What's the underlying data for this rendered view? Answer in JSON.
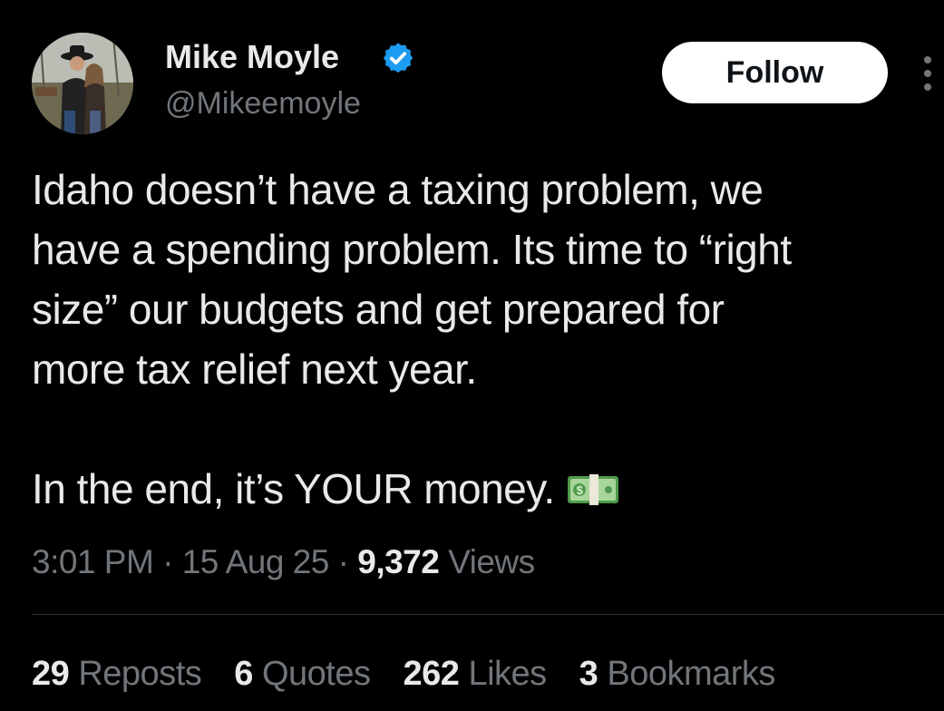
{
  "author": {
    "display_name": "Mike Moyle",
    "handle": "@Mikeemoyle",
    "verified": true,
    "verified_color": "#1d9bf0",
    "avatar_icon": "profile-photo"
  },
  "actions": {
    "follow_label": "Follow",
    "more_icon": "vertical-ellipsis-icon"
  },
  "tweet": {
    "paragraph_1": "Idaho doesn’t have a taxing problem, we\nhave a spending problem. Its time to “right\nsize” our budgets and get prepared for\nmore tax relief next year.",
    "paragraph_2": "In the end, it’s YOUR money.",
    "emoji": "money-with-wings-banknote-emoji"
  },
  "meta": {
    "time": "3:01 PM",
    "separator": "·",
    "date": "15 Aug 25",
    "views_count": "9,372",
    "views_label": "Views"
  },
  "stats": [
    {
      "count": "29",
      "label": "Reposts"
    },
    {
      "count": "6",
      "label": "Quotes"
    },
    {
      "count": "262",
      "label": "Likes"
    },
    {
      "count": "3",
      "label": "Bookmarks"
    }
  ],
  "colors": {
    "background": "#000000",
    "primary_text": "#e7e9ea",
    "secondary_text": "#71767b",
    "divider": "#2f3336",
    "follow_bg": "#ffffff",
    "follow_text": "#0f1419"
  }
}
